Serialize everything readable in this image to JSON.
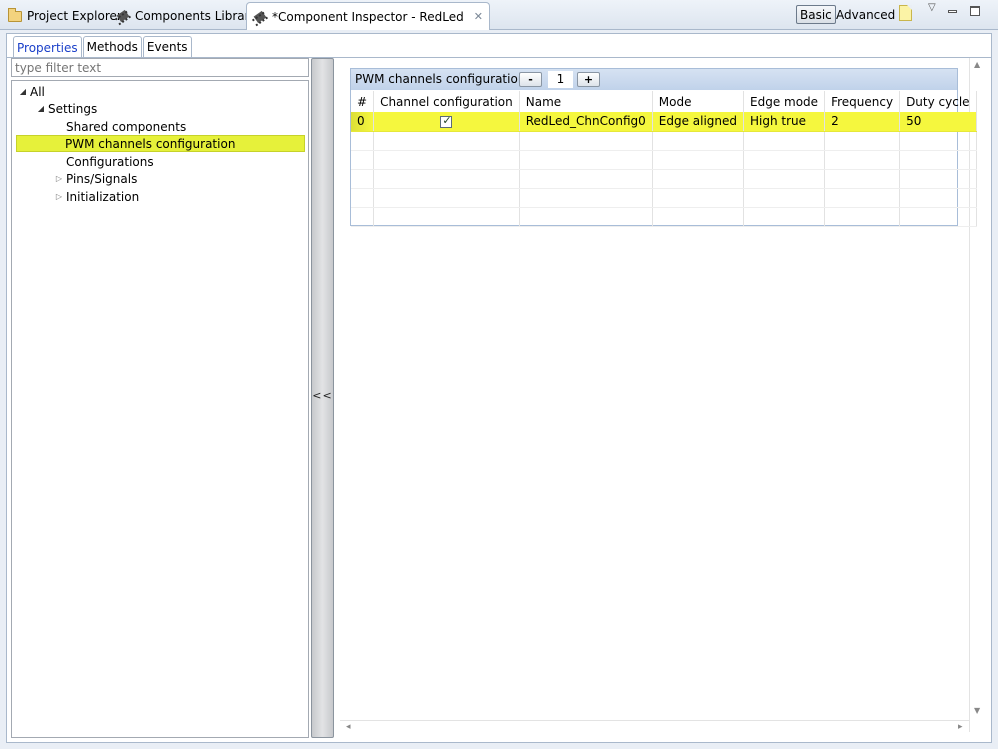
{
  "viewbar": {
    "tabs": [
      {
        "label": "Project Explorer",
        "icon": "folder-icon"
      },
      {
        "label": "Components Library",
        "icon": "chip-icon"
      },
      {
        "label": "*Component Inspector - RedLed",
        "icon": "chip-icon",
        "active": true
      }
    ],
    "basic_label": "Basic",
    "advanced_label": "Advanced"
  },
  "subtabs": [
    "Properties",
    "Methods",
    "Events"
  ],
  "filter": {
    "placeholder": "type filter text"
  },
  "tree": {
    "all": "All",
    "settings": "Settings",
    "shared": "Shared components",
    "pwm": "PWM channels configuration",
    "configurations": "Configurations",
    "pins": "Pins/Signals",
    "init": "Initialization"
  },
  "splitter": {
    "collapse_label": "<<"
  },
  "group": {
    "title": "PWM channels configuration",
    "minus_label": "-",
    "plus_label": "+",
    "count": "1"
  },
  "table": {
    "headers": [
      "#",
      "Channel configuration",
      "Name",
      "Mode",
      "Edge mode",
      "Frequency",
      "Duty cycle"
    ],
    "row": {
      "index": "0",
      "checked": true,
      "name": "RedLed_ChnConfig0",
      "mode": "Edge aligned",
      "edge_mode": "High true",
      "frequency": "2",
      "duty_cycle": "50"
    }
  },
  "colors": {
    "selection": "#e6f13a",
    "row_highlight": "#f5f73e",
    "active_subtab": "#1a3fc9"
  }
}
